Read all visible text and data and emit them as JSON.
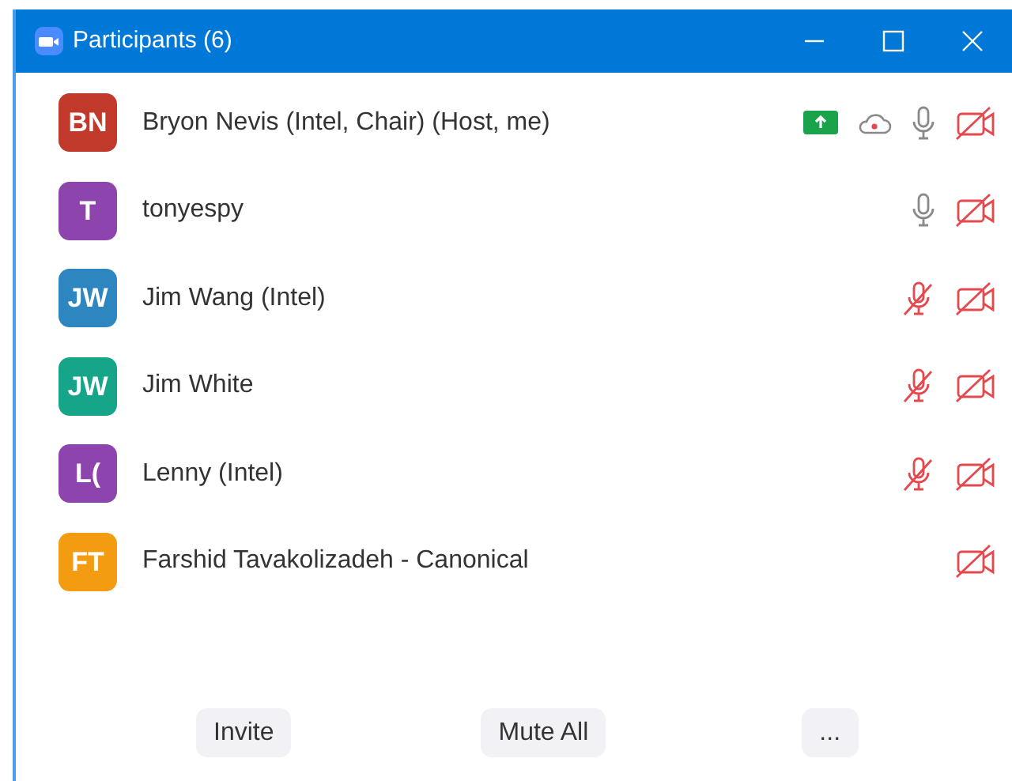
{
  "window": {
    "title": "Participants (6)"
  },
  "participants": [
    {
      "initials": "BN",
      "color": "#c0392b",
      "name": "Bryon Nevis (Intel, Chair) (Host, me)",
      "sharing": true,
      "recording": true,
      "audio": true,
      "muted": false,
      "video_on": false
    },
    {
      "initials": "T",
      "color": "#8e44ad",
      "name": "tonyespy",
      "sharing": false,
      "recording": false,
      "audio": true,
      "muted": false,
      "video_on": false
    },
    {
      "initials": "JW",
      "color": "#2e86c1",
      "name": "Jim Wang (Intel)",
      "sharing": false,
      "recording": false,
      "audio": true,
      "muted": true,
      "video_on": false
    },
    {
      "initials": "JW",
      "color": "#17a589",
      "name": "Jim White",
      "sharing": false,
      "recording": false,
      "audio": true,
      "muted": true,
      "video_on": false
    },
    {
      "initials": "L(",
      "color": "#8e44ad",
      "name": "Lenny (Intel)",
      "sharing": false,
      "recording": false,
      "audio": true,
      "muted": true,
      "video_on": false
    },
    {
      "initials": "FT",
      "color": "#f39c12",
      "name": "Farshid Tavakolizadeh - Canonical",
      "sharing": false,
      "recording": false,
      "audio": false,
      "video_on": false
    }
  ],
  "buttons": [
    "Invite",
    "Mute All",
    "..."
  ]
}
